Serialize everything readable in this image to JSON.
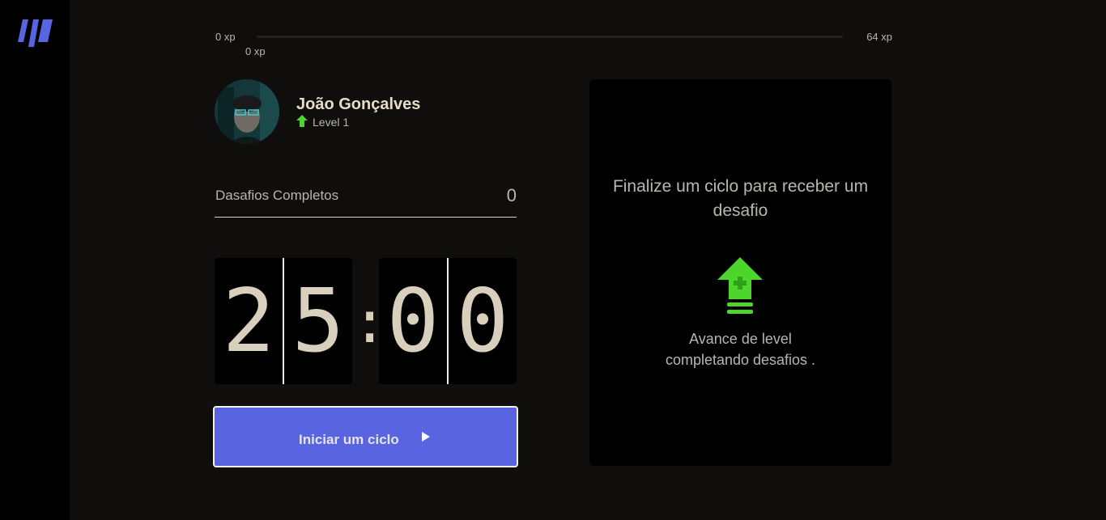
{
  "sidebar": {
    "logo_icon": "logo-icon"
  },
  "experience": {
    "min_label": "0 xp",
    "max_label": "64 xp",
    "current_label": "0 xp",
    "progress_fraction": 0
  },
  "profile": {
    "name": "João Gonçalves",
    "level_label": "Level 1",
    "level_icon": "level-up-arrow-icon",
    "avatar": "avatar-photo"
  },
  "challenges": {
    "label": "Dasafios Completos",
    "count": "0"
  },
  "countdown": {
    "minute_tens": "2",
    "minute_ones": "5",
    "separator": ":",
    "second_tens": "0",
    "second_ones": "0"
  },
  "start_button": {
    "label": "Iniciar um ciclo",
    "icon": "play-icon"
  },
  "challenge_card": {
    "title": "Finalize um ciclo para receber um desafio",
    "icon": "level-up-arrow-icon",
    "hint_line1": "Avance de level",
    "hint_line2": "completando desafios ."
  },
  "colors": {
    "accent": "#5965e0",
    "green": "#4cd62b",
    "background": "#0f0e0c",
    "text": "#b9b6ae"
  }
}
